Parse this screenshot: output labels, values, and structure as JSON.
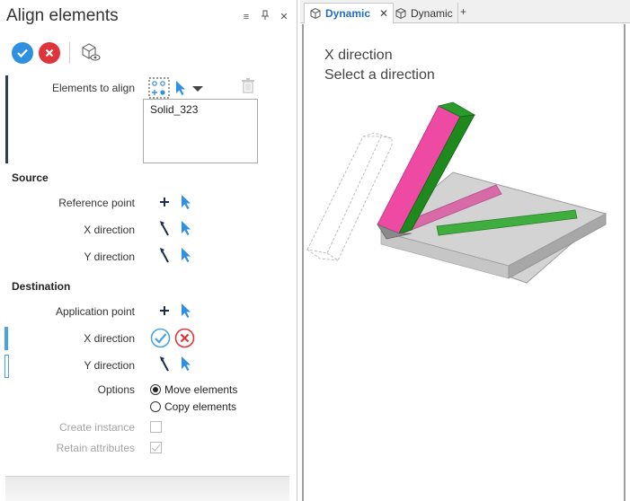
{
  "panel": {
    "title": "Align elements",
    "pin_glyph": "⌖",
    "close_glyph": "✕",
    "menu_glyph": "≡",
    "elements_to_align_label": "Elements to align",
    "selected_elements": [
      "Solid_323"
    ],
    "source_title": "Source",
    "reference_point_label": "Reference point",
    "src_x_direction_label": "X direction",
    "src_y_direction_label": "Y direction",
    "destination_title": "Destination",
    "application_point_label": "Application point",
    "dst_x_direction_label": "X direction",
    "dst_y_direction_label": "Y direction",
    "options_label": "Options",
    "option_move": "Move elements",
    "option_copy": "Copy elements",
    "selected_option": "move",
    "create_instance_label": "Create instance",
    "create_instance_checked": false,
    "retain_attributes_label": "Retain attributes",
    "retain_attributes_checked": true
  },
  "tabs": [
    {
      "label": "Dynamic",
      "active": true,
      "close": "✕"
    },
    {
      "label": "Dynamic",
      "active": false
    }
  ],
  "tab_add": "+",
  "viewport": {
    "prompt_line1": "X direction",
    "prompt_line2": "Select a direction"
  },
  "colors": {
    "accent_blue": "#2f8fe0",
    "cancel_red": "#e0343b",
    "pink_face": "#ee4aa3",
    "green_face": "#1e8a1e",
    "slab_top": "#cfcfcf"
  }
}
